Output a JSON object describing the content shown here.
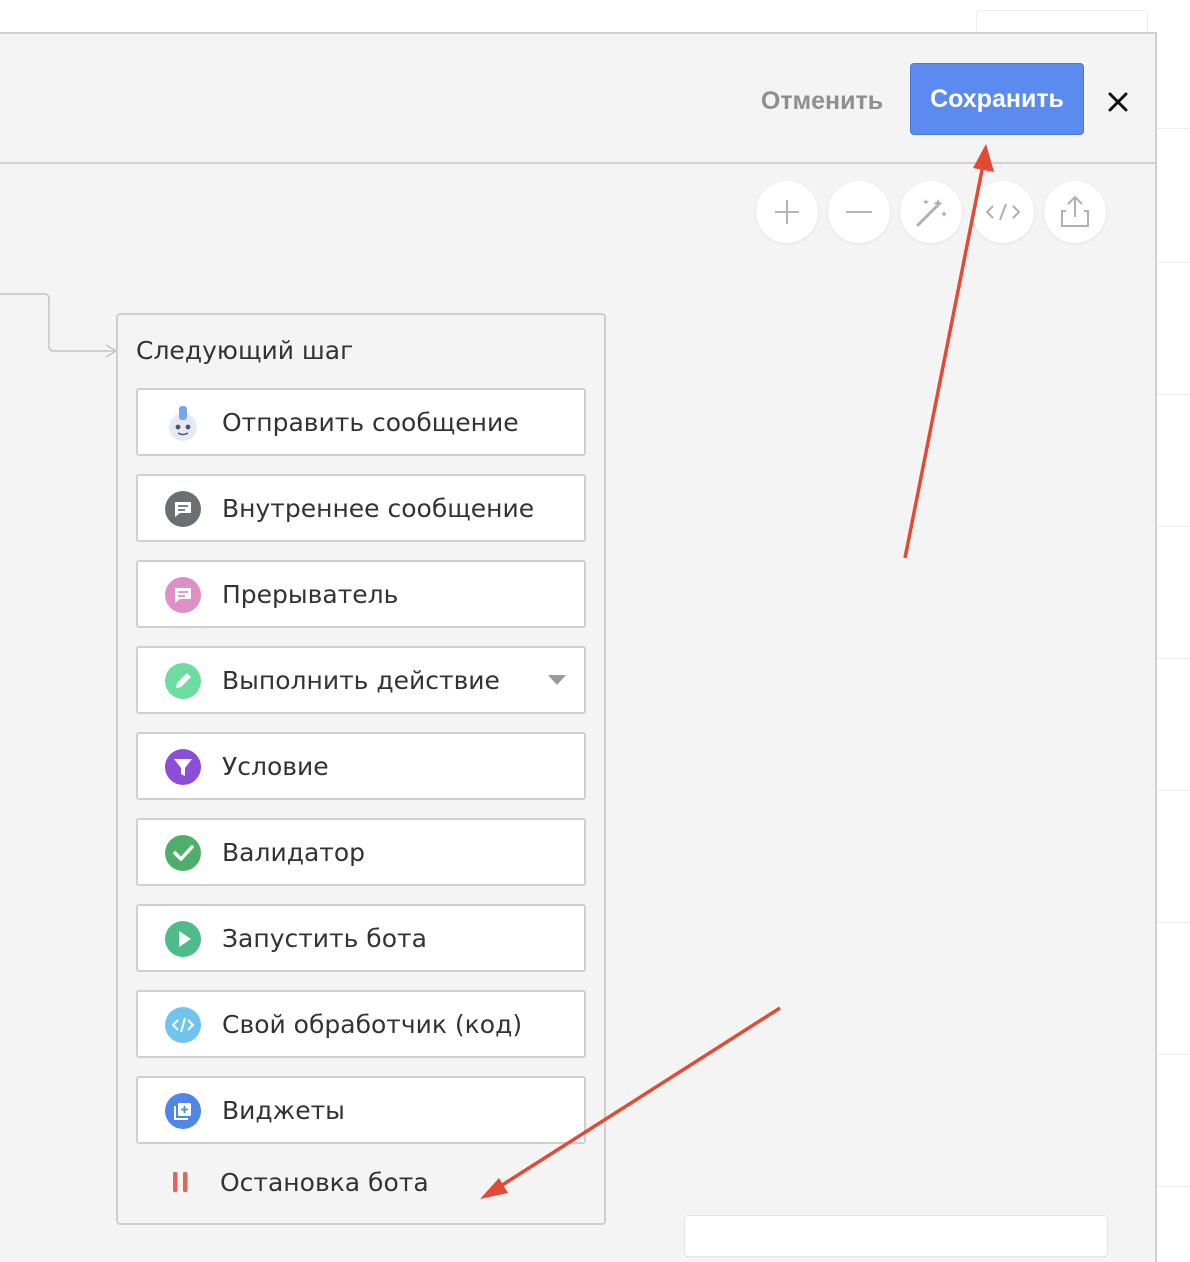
{
  "header": {
    "cancel_label": "Отменить",
    "save_label": "Сохранить",
    "close_icon": "close-icon"
  },
  "toolbar": {
    "buttons": [
      {
        "name": "zoom-in",
        "icon": "plus-icon"
      },
      {
        "name": "zoom-out",
        "icon": "minus-icon"
      },
      {
        "name": "auto-layout",
        "icon": "magic-wand-icon"
      },
      {
        "name": "code-view",
        "icon": "code-icon"
      },
      {
        "name": "export",
        "icon": "share-icon"
      }
    ]
  },
  "next_step": {
    "title": "Следующий шаг",
    "items": [
      {
        "label": "Отправить сообщение",
        "icon": "bot-face-icon",
        "color": "#7aa5e6"
      },
      {
        "label": "Внутреннее сообщение",
        "icon": "chat-bubble-icon",
        "color": "#6b6f73"
      },
      {
        "label": "Прерыватель",
        "icon": "chat-bubble-icon",
        "color": "#de8fc6"
      },
      {
        "label": "Выполнить действие",
        "icon": "pencil-icon",
        "color": "#6fdc9f"
      },
      {
        "label": "Условие",
        "icon": "filter-icon",
        "color": "#8a4fd6"
      },
      {
        "label": "Валидатор",
        "icon": "check-icon",
        "color": "#4fae6a"
      },
      {
        "label": "Запустить бота",
        "icon": "play-icon",
        "color": "#4fba8a"
      },
      {
        "label": "Свой обработчик (код)",
        "icon": "code-icon",
        "color": "#6ec4ef"
      },
      {
        "label": "Виджеты",
        "icon": "widgets-icon",
        "color": "#4f86e8"
      },
      {
        "label": "Остановка бота",
        "icon": "pause-icon",
        "color": "#e0655e"
      }
    ]
  },
  "colors": {
    "accent": "#5c8bf0",
    "annotation_arrow": "#e24a34",
    "canvas_bg": "#f4f4f4"
  }
}
